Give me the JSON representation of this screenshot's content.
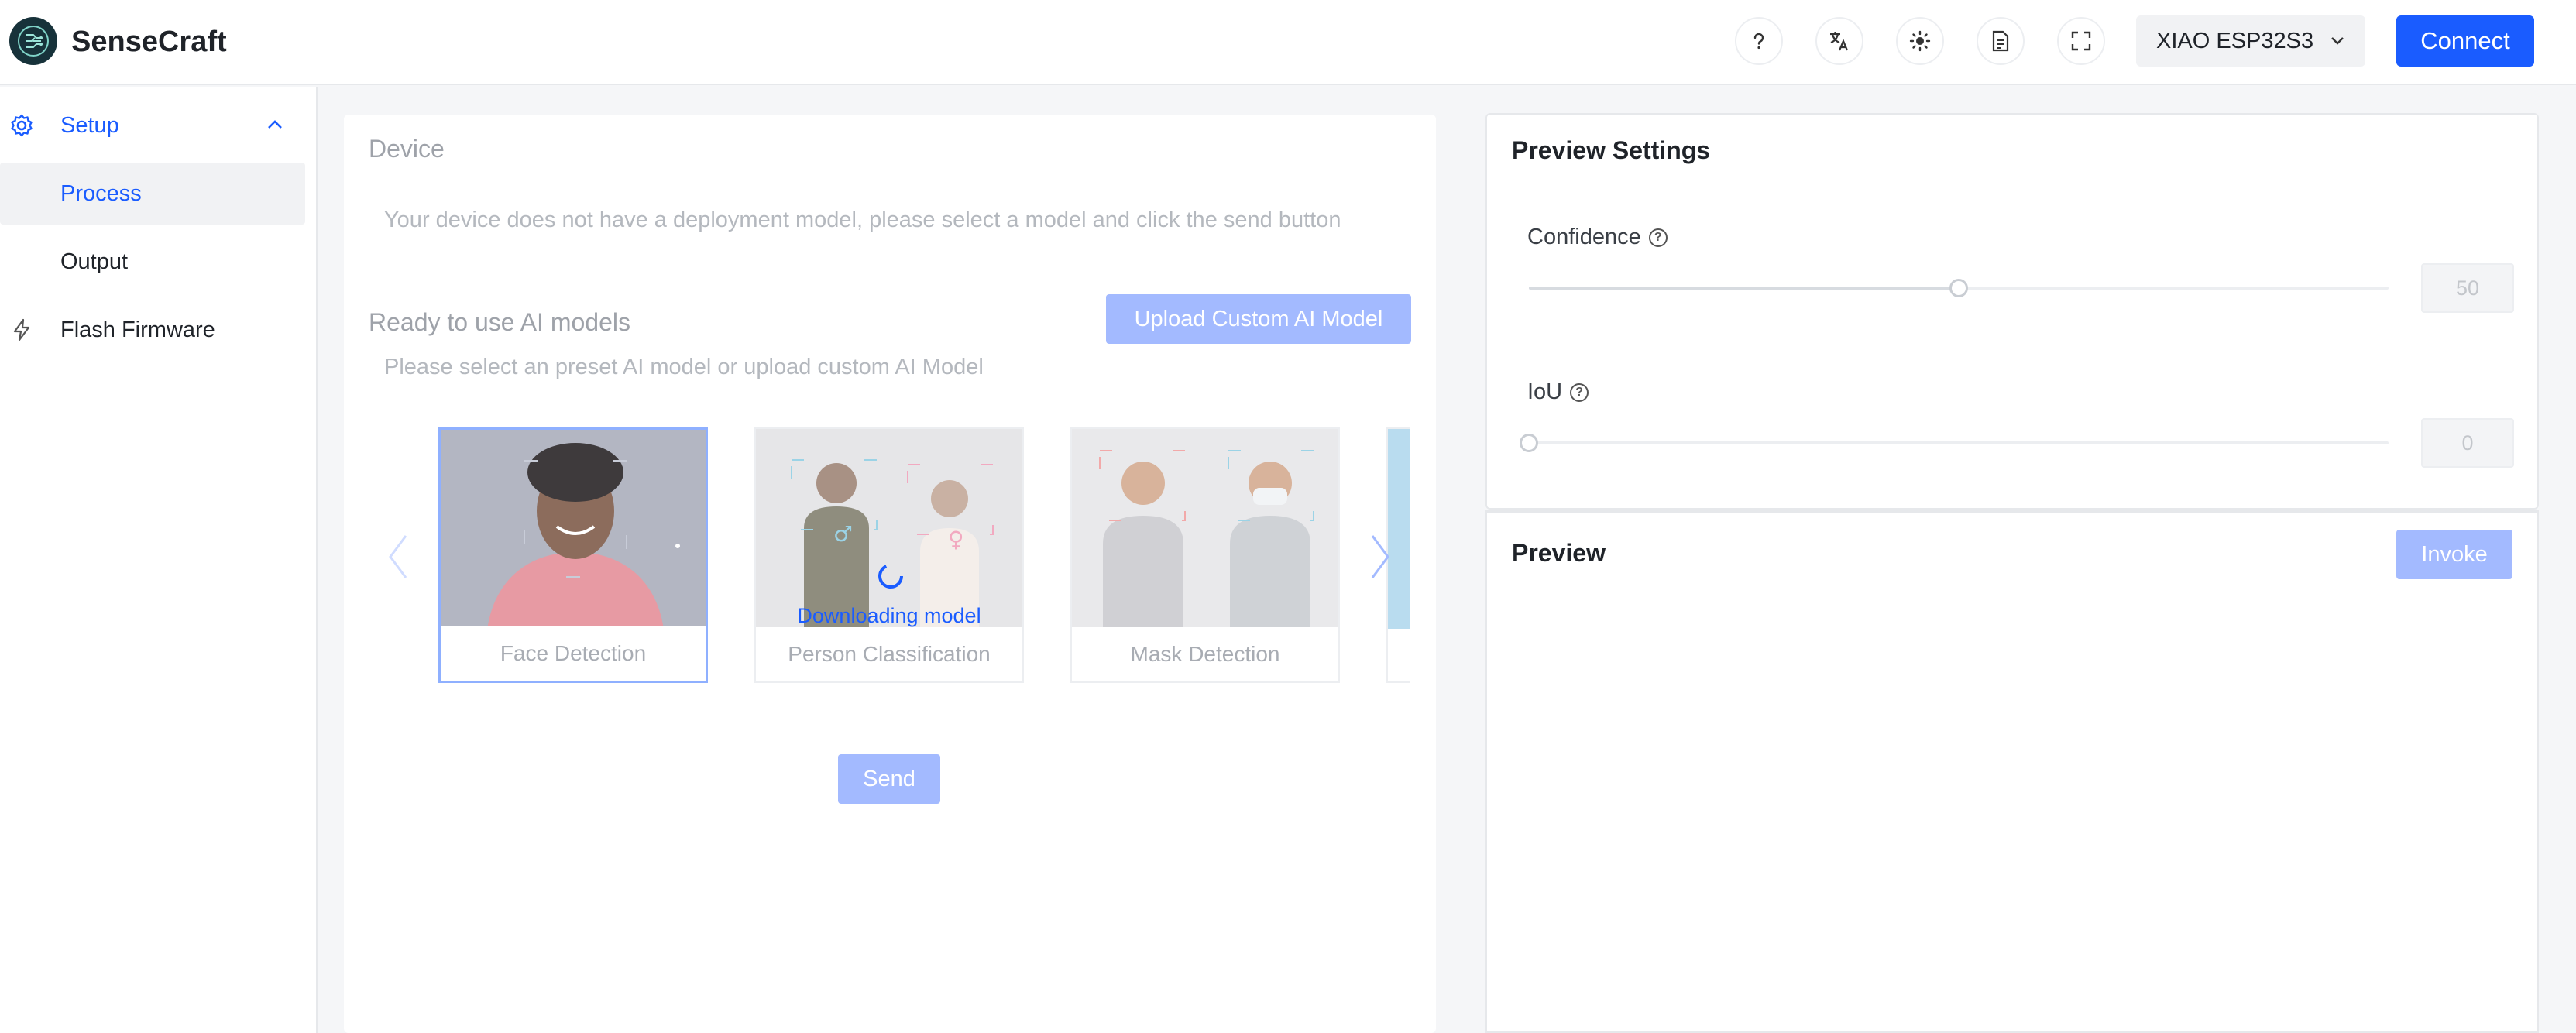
{
  "app": {
    "title": "SenseCraft"
  },
  "header": {
    "icons": [
      "help-icon",
      "translate-icon",
      "theme-icon",
      "docs-icon",
      "fullscreen-icon"
    ],
    "device_select": "XIAO ESP32S3",
    "connect_label": "Connect"
  },
  "sidebar": {
    "setup_label": "Setup",
    "items": [
      {
        "label": "Process",
        "active": true
      },
      {
        "label": "Output",
        "active": false
      }
    ],
    "flash_label": "Flash Firmware"
  },
  "device_panel": {
    "title": "Device",
    "message": "Your device does not have a deployment model, please select a model and click the send button",
    "models_title": "Ready to use AI models",
    "models_hint": "Please select an preset AI model or upload custom AI Model",
    "upload_label": "Upload Custom AI Model",
    "models": [
      {
        "name": "Face Detection",
        "selected": true
      },
      {
        "name": "Person Classification",
        "status": "Downloading model"
      },
      {
        "name": "Mask Detection"
      }
    ],
    "send_label": "Send"
  },
  "preview_settings": {
    "title": "Preview Settings",
    "confidence_label": "Confidence",
    "confidence_value": "50",
    "iou_label": "IoU",
    "iou_value": "0"
  },
  "preview": {
    "title": "Preview",
    "invoke_label": "Invoke"
  },
  "colors": {
    "accent": "#1a5cff",
    "accent_disabled": "#a3baff"
  }
}
